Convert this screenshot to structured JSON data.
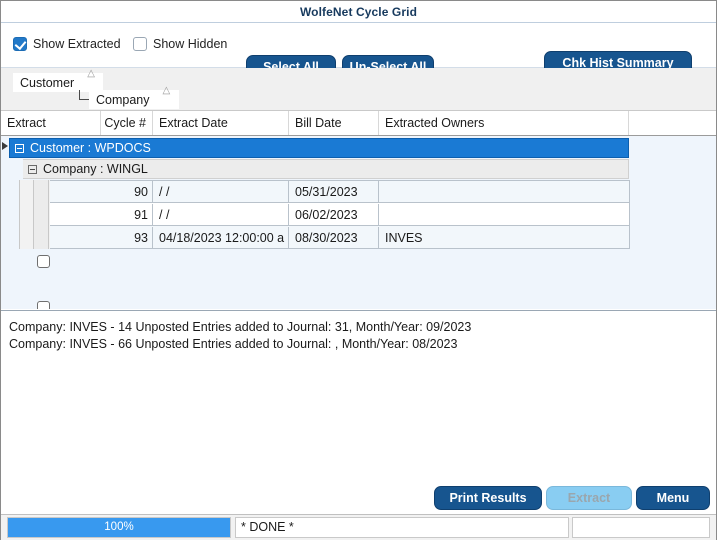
{
  "window": {
    "title": "WolfeNet Cycle Grid"
  },
  "toolbar": {
    "show_extracted": {
      "label": "Show Extracted",
      "checked": true
    },
    "show_hidden": {
      "label": "Show Hidden",
      "checked": false
    },
    "select_all_label": "Select All",
    "unselect_all_label": "Un-Select All",
    "chk_hist_summary_label": "Chk Hist Summary",
    "accent_color": "#17558f"
  },
  "group_panel": {
    "chips": [
      {
        "label": "Customer",
        "sort": "ascending"
      },
      {
        "label": "Company",
        "sort": "ascending"
      }
    ]
  },
  "grid": {
    "columns": [
      {
        "label": "Extract",
        "align": "left"
      },
      {
        "label": "Cycle #",
        "align": "right"
      },
      {
        "label": "Extract Date",
        "align": "left"
      },
      {
        "label": "Bill Date",
        "align": "left"
      },
      {
        "label": "Extracted Owners",
        "align": "left"
      }
    ],
    "groups": [
      {
        "level": 1,
        "label": "Customer : WPDOCS",
        "selected": true,
        "expanded": true,
        "highlight_color": "#1a7ad4"
      },
      {
        "level": 2,
        "label": "Company : WINGL",
        "selected": false,
        "expanded": true
      }
    ],
    "rows": [
      {
        "checked": false,
        "cycle": "90",
        "extract_date": "/  /",
        "bill_date": "05/31/2023",
        "extracted_owners": ""
      },
      {
        "checked": false,
        "cycle": "91",
        "extract_date": "/  /",
        "bill_date": "06/02/2023",
        "extracted_owners": ""
      },
      {
        "checked": false,
        "cycle": "93",
        "extract_date": "04/18/2023 12:00:00 a",
        "bill_date": "08/30/2023",
        "extracted_owners": "INVES"
      }
    ]
  },
  "log": {
    "lines": [
      "Company: INVES - 14 Unposted Entries added to Journal:  31, Month/Year: 09/2023",
      "Company: INVES - 66 Unposted Entries added to Journal: , Month/Year: 08/2023"
    ]
  },
  "footer": {
    "print_results_label": "Print Results",
    "extract_label": "Extract",
    "extract_enabled": false,
    "menu_label": "Menu"
  },
  "statusbar": {
    "progress_percent": "100%",
    "progress_value": 100,
    "progress_color": "#3899ef",
    "status_text": "* DONE *",
    "extra_text": ""
  }
}
